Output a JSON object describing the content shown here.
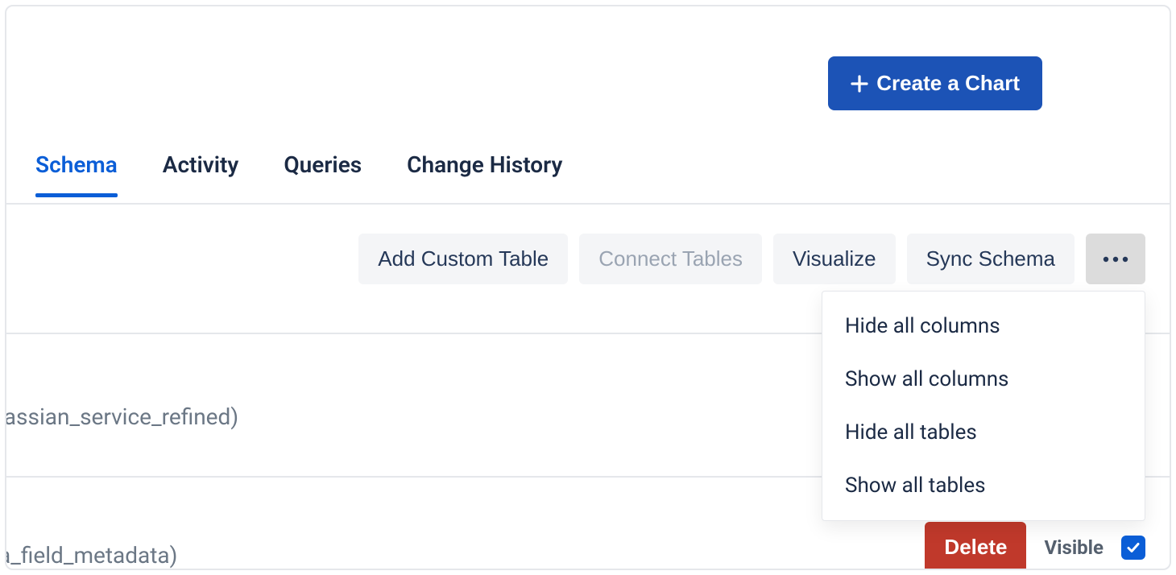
{
  "header": {
    "create_chart_label": "Create a Chart"
  },
  "tabs": [
    {
      "label": "Schema",
      "active": true
    },
    {
      "label": "Activity",
      "active": false
    },
    {
      "label": "Queries",
      "active": false
    },
    {
      "label": "Change History",
      "active": false
    }
  ],
  "toolbar": {
    "add_custom_table": "Add Custom Table",
    "connect_tables": "Connect Tables",
    "visualize": "Visualize",
    "sync_schema": "Sync Schema"
  },
  "more_menu": {
    "items": [
      "Hide all columns",
      "Show all columns",
      "Hide all tables",
      "Show all tables"
    ]
  },
  "rows": [
    {
      "text_fragment": "lassian_service_refined)"
    },
    {
      "text_fragment": "a_field_metadata)"
    }
  ],
  "row_actions": {
    "delete_label": "Delete",
    "visible_label": "Visible",
    "visible_checked": true
  }
}
